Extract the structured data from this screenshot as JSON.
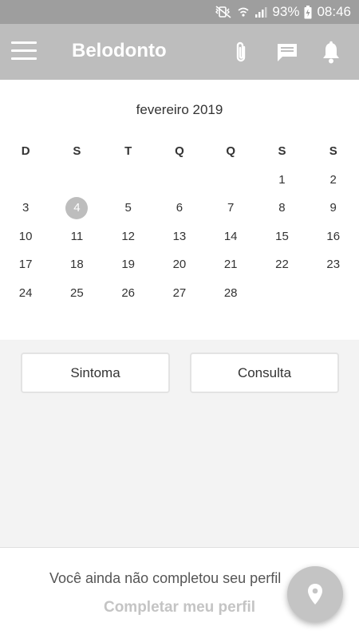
{
  "status_bar": {
    "battery": "93%",
    "time": "08:46",
    "icons": [
      "mute-vibrate-icon",
      "wifi-icon",
      "signal-icon",
      "battery-charging-icon"
    ]
  },
  "app_bar": {
    "title": "Belodonto",
    "icons": [
      "menu-icon",
      "attachment-icon",
      "chat-icon",
      "bell-icon"
    ]
  },
  "calendar": {
    "month_title": "fevereiro 2019",
    "weekdays": [
      "D",
      "S",
      "T",
      "Q",
      "Q",
      "S",
      "S"
    ],
    "weeks": [
      [
        "",
        "",
        "",
        "",
        "",
        "1",
        "2"
      ],
      [
        "3",
        "4",
        "5",
        "6",
        "7",
        "8",
        "9"
      ],
      [
        "10",
        "11",
        "12",
        "13",
        "14",
        "15",
        "16"
      ],
      [
        "17",
        "18",
        "19",
        "20",
        "21",
        "22",
        "23"
      ],
      [
        "24",
        "25",
        "26",
        "27",
        "28",
        "",
        ""
      ]
    ],
    "selected_day": "4"
  },
  "actions": {
    "symptom_label": "Sintoma",
    "appointment_label": "Consulta"
  },
  "footer": {
    "message": "Você ainda não completou seu perfil",
    "link_label": "Completar meu perfil"
  },
  "fab": {
    "icon": "location-pin-icon"
  },
  "colors": {
    "status_bar": "#9e9e9e",
    "app_bar": "#bdbdbd",
    "selected_day": "#bdbdbd",
    "middle_bg": "#f3f3f3",
    "fab": "#c4c4c4",
    "link": "#c4c4c4"
  }
}
